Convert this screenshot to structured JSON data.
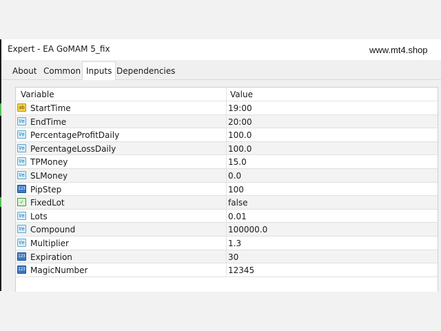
{
  "window": {
    "title": "Expert - EA GoMAM 5_fix",
    "watermark": "www.mt4.shop"
  },
  "tabs": [
    {
      "label": "About"
    },
    {
      "label": "Common"
    },
    {
      "label": "Inputs",
      "active": true
    },
    {
      "label": "Dependencies"
    }
  ],
  "table": {
    "columns": [
      "Variable",
      "Value"
    ],
    "rows": [
      {
        "icon": "ab",
        "name": "StartTime",
        "value": "19:00"
      },
      {
        "icon": "Ve",
        "name": "EndTime",
        "value": "20:00"
      },
      {
        "icon": "Ve",
        "name": "PercentageProfitDaily",
        "value": "100.0"
      },
      {
        "icon": "Ve",
        "name": "PercentageLossDaily",
        "value": "100.0"
      },
      {
        "icon": "Ve",
        "name": "TPMoney",
        "value": "15.0"
      },
      {
        "icon": "Ve",
        "name": "SLMoney",
        "value": "0.0"
      },
      {
        "icon": "123",
        "name": "PipStep",
        "value": "100"
      },
      {
        "icon": "bool",
        "name": "FixedLot",
        "value": "false"
      },
      {
        "icon": "Ve",
        "name": "Lots",
        "value": "0.01"
      },
      {
        "icon": "Ve",
        "name": "Compound",
        "value": "100000.0"
      },
      {
        "icon": "Ve",
        "name": "Multiplier",
        "value": "1.3"
      },
      {
        "icon": "123",
        "name": "Expiration",
        "value": "30"
      },
      {
        "icon": "123",
        "name": "MagicNumber",
        "value": "12345"
      }
    ]
  },
  "icon_names": {
    "ab": "string-type-icon",
    "Ve": "double-type-icon",
    "123": "integer-type-icon",
    "bool": "bool-type-icon"
  }
}
